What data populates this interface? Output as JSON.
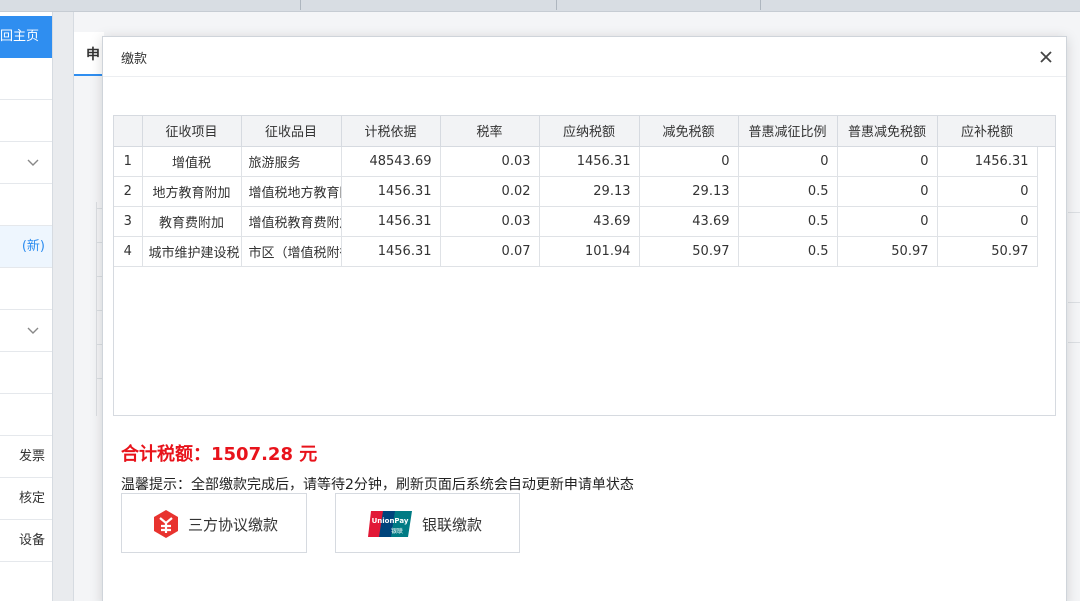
{
  "sidebar": {
    "home_label": "回主页",
    "items": [
      {
        "label": "",
        "chevron": false
      },
      {
        "label": "",
        "chevron": false
      },
      {
        "label": "",
        "chevron": true
      },
      {
        "label": "",
        "chevron": false
      },
      {
        "label": "(新)",
        "chevron": false,
        "active": true
      },
      {
        "label": "",
        "chevron": false
      },
      {
        "label": "",
        "chevron": true
      },
      {
        "label": "",
        "chevron": false
      },
      {
        "label": "",
        "chevron": false
      },
      {
        "label": "发票",
        "chevron": false
      },
      {
        "label": "核定",
        "chevron": false
      },
      {
        "label": "设备",
        "chevron": false
      }
    ]
  },
  "background": {
    "tab_label": "申"
  },
  "modal": {
    "title": "缴款",
    "close_icon": "close-icon"
  },
  "table": {
    "headers": [
      "",
      "征收项目",
      "征收品目",
      "计税依据",
      "税率",
      "应纳税额",
      "减免税额",
      "普惠减征比例",
      "普惠减免税额",
      "应补税额"
    ],
    "rows": [
      [
        "1",
        "增值税",
        "旅游服务",
        "48543.69",
        "0.03",
        "1456.31",
        "0",
        "0",
        "0",
        "1456.31"
      ],
      [
        "2",
        "地方教育附加",
        "增值税地方教育附加",
        "1456.31",
        "0.02",
        "29.13",
        "29.13",
        "0.5",
        "0",
        "0"
      ],
      [
        "3",
        "教育费附加",
        "增值税教育费附加",
        "1456.31",
        "0.03",
        "43.69",
        "43.69",
        "0.5",
        "0",
        "0"
      ],
      [
        "4",
        "城市维护建设税",
        "市区（增值税附征）",
        "1456.31",
        "0.07",
        "101.94",
        "50.97",
        "0.5",
        "50.97",
        "50.97"
      ]
    ]
  },
  "summary": {
    "total_label": "合计税额：1507.28 元",
    "tip": "温馨提示：全部缴款完成后，请等待2分钟，刷新页面后系统会自动更新申请单状态"
  },
  "payment": {
    "tripartite_label": "三方协议缴款",
    "unionpay_label": "银联缴款",
    "unionpay_logo_text": "UnionPay",
    "unionpay_logo_cn": "银联"
  },
  "colors": {
    "accent": "#2f8ef0",
    "total_red": "#e8131b",
    "logo_red": "#e8332f"
  }
}
